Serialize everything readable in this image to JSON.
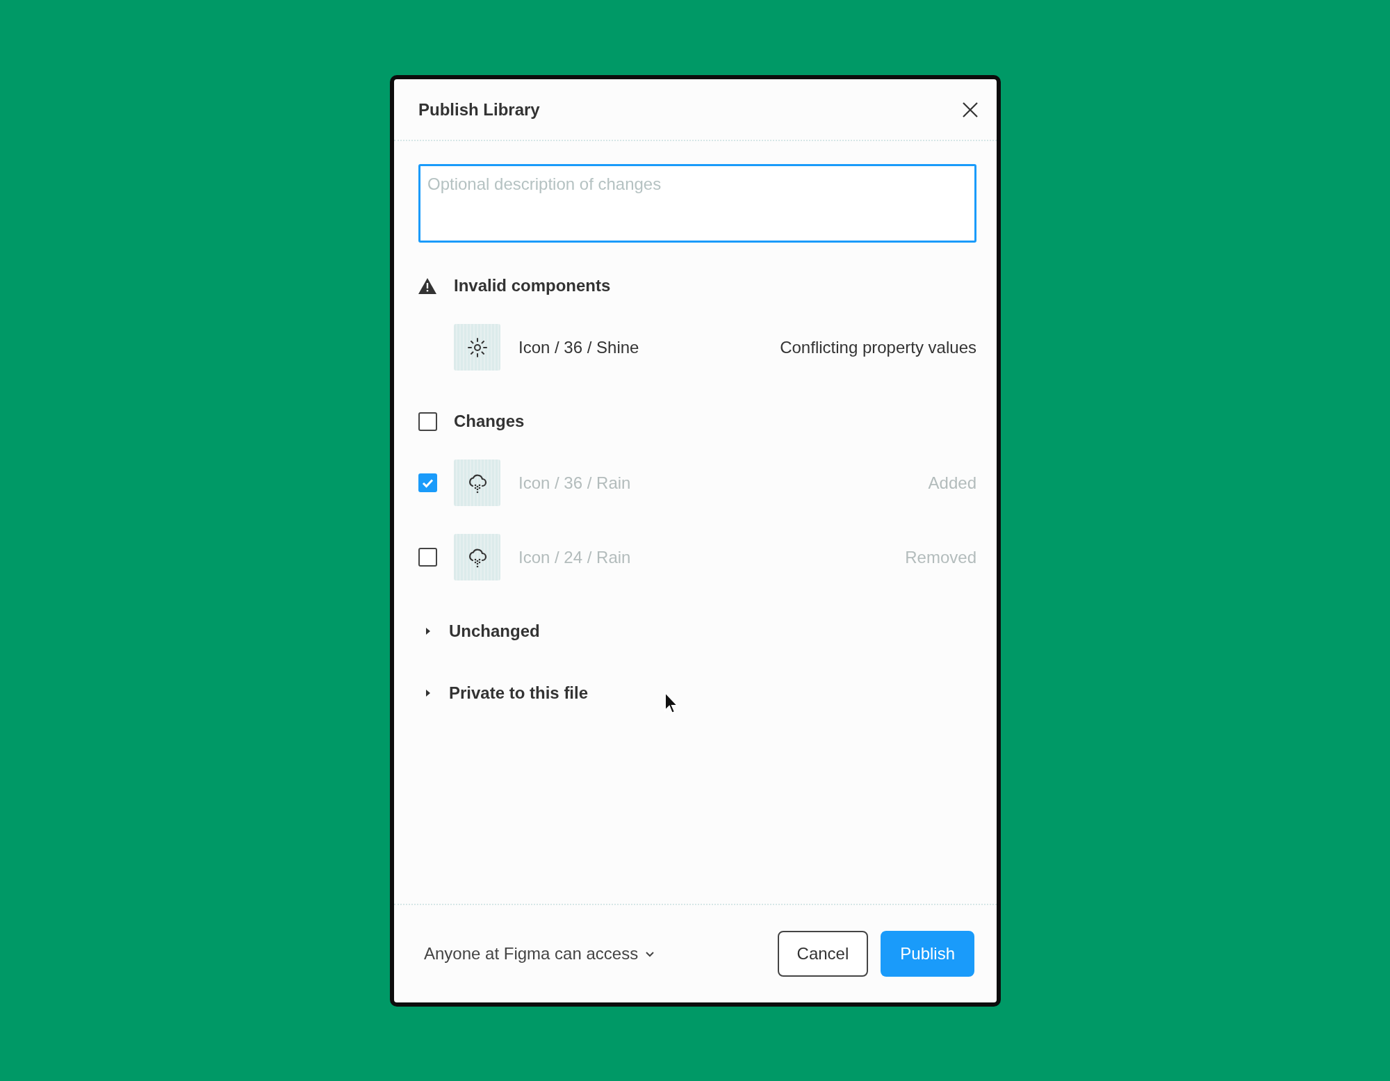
{
  "dialog": {
    "title": "Publish Library"
  },
  "description": {
    "placeholder": "Optional description of changes"
  },
  "invalid_section": {
    "title": "Invalid components",
    "items": [
      {
        "name": "Icon / 36 / Shine",
        "status": "Conflicting property values"
      }
    ]
  },
  "changes_section": {
    "title": "Changes",
    "checked": false,
    "items": [
      {
        "name": "Icon / 36 / Rain",
        "status": "Added",
        "checked": true
      },
      {
        "name": "Icon / 24 / Rain",
        "status": "Removed",
        "checked": false
      }
    ]
  },
  "collapsed_sections": [
    {
      "title": "Unchanged",
      "expanded": false
    },
    {
      "title": "Private to this file",
      "expanded": false
    }
  ],
  "footer": {
    "access": "Anyone at Figma can access",
    "buttons": [
      {
        "label": "Cancel",
        "kind": "secondary"
      },
      {
        "label": "Publish",
        "kind": "primary"
      }
    ]
  }
}
